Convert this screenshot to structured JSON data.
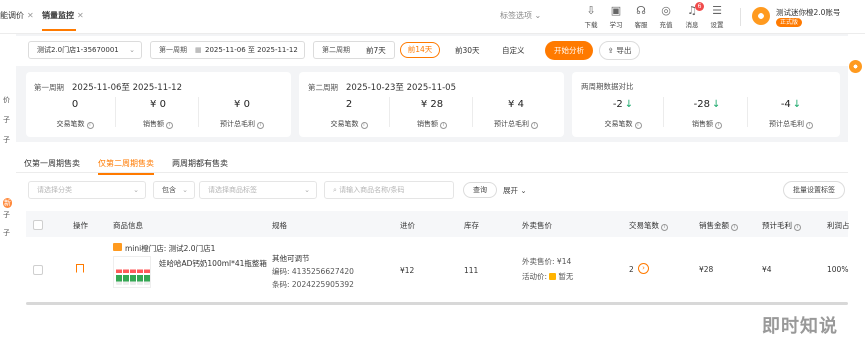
{
  "tabs": [
    {
      "label": "能调价",
      "closable": true
    },
    {
      "label": "销量监控",
      "closable": true
    }
  ],
  "top_selector": "标签选项 ⌄",
  "toolbar": [
    {
      "label": "下载",
      "icon": "download-icon"
    },
    {
      "label": "学习",
      "icon": "learn-icon"
    },
    {
      "label": "客服",
      "icon": "service-icon"
    },
    {
      "label": "充值",
      "icon": "recharge-icon"
    },
    {
      "label": "消息",
      "icon": "bell-icon",
      "badge": "6"
    },
    {
      "label": "设置",
      "icon": "settings-icon"
    }
  ],
  "account": {
    "name": "测试迷你橙2.0账号",
    "badge": "正式版"
  },
  "left_strip": [
    "价",
    "子",
    "子",
    "新",
    "子",
    "子"
  ],
  "filters": {
    "store": "测试2.0门店1-35670001",
    "period1": {
      "label": "第一周期",
      "value": "2025-11-06 至 2025-11-12"
    },
    "period2": {
      "label": "第二周期"
    },
    "quick": [
      "前7天",
      "前14天",
      "前30天",
      "自定义"
    ],
    "quick_selected": "前14天",
    "start": "开始分析",
    "export": "导出"
  },
  "cards": [
    {
      "title": "第一周期",
      "range": "2025-11-06至 2025-11-12",
      "metrics": [
        {
          "value": "0",
          "label": "交易笔数"
        },
        {
          "value": "¥ 0",
          "label": "销售额"
        },
        {
          "value": "¥ 0",
          "label": "预计总毛利"
        }
      ]
    },
    {
      "title": "第二周期",
      "range": "2025-10-23至 2025-11-05",
      "metrics": [
        {
          "value": "2",
          "label": "交易笔数"
        },
        {
          "value": "¥ 28",
          "label": "销售额"
        },
        {
          "value": "¥ 4",
          "label": "预计总毛利"
        }
      ]
    },
    {
      "title": "两周期数据对比",
      "range": "",
      "metrics": [
        {
          "value": "-2",
          "label": "交易笔数",
          "trend": "↓"
        },
        {
          "value": "-28",
          "label": "销售额",
          "trend": "↓"
        },
        {
          "value": "-4",
          "label": "预计总毛利",
          "trend": "↓"
        }
      ]
    }
  ],
  "section_tabs": [
    "仅第一周期售卖",
    "仅第二周期售卖",
    "两周期都有售卖"
  ],
  "section_tab_selected": "仅第二周期售卖",
  "search": {
    "category_placeholder": "请选择分类",
    "include": "包含",
    "tags_placeholder": "请选择商品标签",
    "keyword_placeholder": "请输入商品名称/条码",
    "query": "查询",
    "expand": "展开",
    "batch": "批量设置标签"
  },
  "table": {
    "headers": [
      "操作",
      "商品信息",
      "规格",
      "进价",
      "库存",
      "外卖售价",
      "交易笔数",
      "销售金额",
      "预计毛利",
      "利润占"
    ],
    "rows": [
      {
        "store": "mini橙门店: 测试2.0门店1",
        "name": "娃哈哈AD钙奶100ml*41瓶整箱",
        "spec": "其他可调节",
        "code": "编码: 4135256627420",
        "barcode": "条码: 2024225905392",
        "cost": "¥12",
        "stock": "111",
        "delivery_price_label": "外卖售价:",
        "delivery_price": "¥14",
        "activity_label": "活动价:",
        "activity_value": "暂无",
        "trades": "2",
        "sales": "¥28",
        "profit": "¥4",
        "ratio": "100%"
      }
    ]
  },
  "watermark": "即时知说",
  "colors": {
    "accent": "#ff7a00",
    "down": "#19a86b",
    "badge": "#f04b4b"
  }
}
